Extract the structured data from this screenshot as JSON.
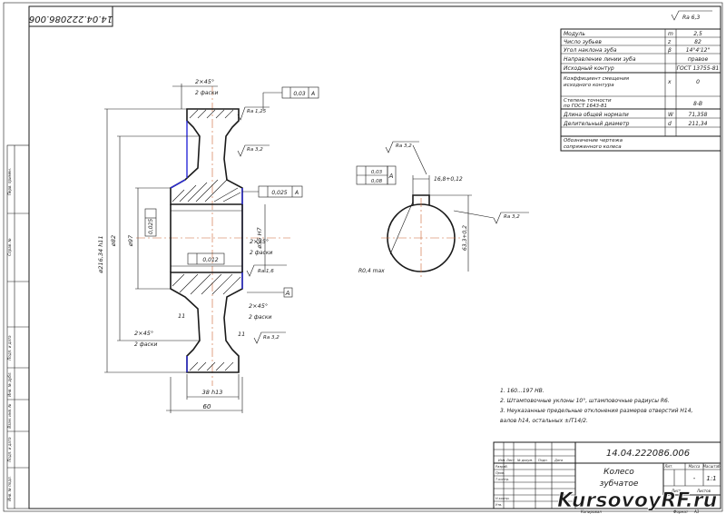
{
  "drawing_number": "14.04.222086.006",
  "part_name_line1": "Колесо",
  "part_name_line2": "зубчатое",
  "roughness_general": "Ra 6,3",
  "params": [
    {
      "name": "Модуль",
      "sym": "m",
      "val": "2,5"
    },
    {
      "name": "Число зубьев",
      "sym": "z",
      "val": "82"
    },
    {
      "name": "Угол наклона зуба",
      "sym": "β",
      "val": "14°4'12\""
    },
    {
      "name": "Направление линии зуба",
      "sym": "",
      "val": "правое"
    },
    {
      "name": "Исходный контур",
      "sym": "",
      "val": "ГОСТ 13755-81"
    },
    {
      "name": "Коэффициент смещения исходного контура",
      "sym": "x",
      "val": "0"
    },
    {
      "name": "Степень точности по ГОСТ 1643-81",
      "sym": "",
      "val": "8-В"
    },
    {
      "name": "Длина общей нормали",
      "sym": "W",
      "val": "71,358"
    },
    {
      "name": "Делительный диаметр",
      "sym": "d",
      "val": "211,34"
    },
    {
      "name": "Обозначение чертежа сопряженного колеса",
      "sym": "",
      "val": ""
    }
  ],
  "notes": [
    "1. 160...197 НВ.",
    "2. Штамповочные уклоны 10°, штамповочные радиусы R6.",
    "3. Неуказанные предельные отклонения размеров отверстий H14,",
    "валов h14, остальных ±IT14/2."
  ],
  "dims": {
    "chamfer1": "2×45°",
    "chamfer1b": "2 фаски",
    "chamfer2": "2×45°",
    "chamfer2b": "2 фаски",
    "chamfer3": "2×45°",
    "chamfer3b": "2 фаски",
    "chamfer4": "2×45°",
    "chamfer4b": "2 фаски",
    "d_outer": "ø216,34 h11",
    "d_hub": "ø82",
    "d_web": "ø97",
    "d_bore": "ø55 H7",
    "width": "60",
    "rim": "38 h13",
    "web": "11",
    "web2": "11",
    "tol_runout": "0,03",
    "tol_face": "0,025",
    "tol_cyl": "0,012",
    "tol_side": "0,025",
    "datum": "A",
    "keyway": "16,8+0,12",
    "key_depth": "63,3+0,2",
    "key_r": "R0,4 max",
    "key_par": "0,03",
    "key_sym": "0,08",
    "ra_tooth": "Ra 1,25",
    "ra_web": "Ra 3,2",
    "ra_bore": "Ra 1,6",
    "ra_face": "Ra 3,2",
    "ra_key": "Ra 3,2",
    "ra_key2": "Ra 3,2"
  },
  "title_block": {
    "lit": "Лит.",
    "mass": "Масса",
    "scale": "Масштаб",
    "mass_val": "-",
    "scale_val": "1:1",
    "sheet": "Лист",
    "sheets": "Листов",
    "format": "Формат",
    "format_val": "A3",
    "copied": "Копировал",
    "izm": "Изм.",
    "list": "Лист",
    "ndoc": "№ докум.",
    "podp": "Подп.",
    "data": "Дата",
    "razrab": "Разраб.",
    "prov": "Пров.",
    "tkontr": "Т.контр.",
    "nkontr": "Н.контр.",
    "utv": "Утв."
  },
  "side_labels": [
    "Перв. примен.",
    "Справ. №",
    "Подп. и дата",
    "Инв. № дубл.",
    "Взам. инв. №",
    "Подп. и дата",
    "Инв. № подл."
  ],
  "watermark": "KursovoyRF.ru"
}
